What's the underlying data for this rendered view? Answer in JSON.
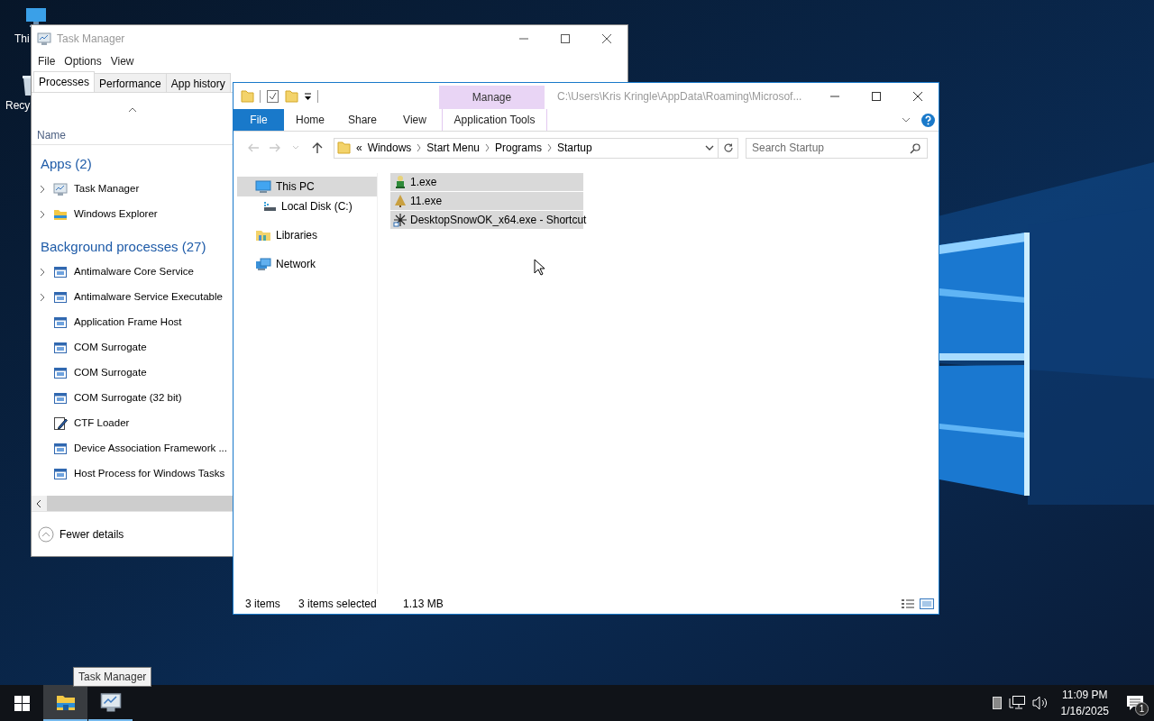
{
  "desktop": {
    "icons": [
      {
        "label": "Thi",
        "kind": "pc"
      },
      {
        "label": "Recy",
        "kind": "bin"
      }
    ]
  },
  "task_manager": {
    "title": "Task Manager",
    "menu": [
      "File",
      "Options",
      "View"
    ],
    "tabs": [
      {
        "label": "Processes",
        "selected": true
      },
      {
        "label": "Performance",
        "selected": false
      },
      {
        "label": "App history",
        "selected": false
      }
    ],
    "column": "Name",
    "groups": [
      {
        "title": "Apps (2)",
        "rows": [
          {
            "name": "Task Manager",
            "kind": "taskmgr",
            "expandable": true
          },
          {
            "name": "Windows Explorer",
            "kind": "explorer",
            "expandable": true
          }
        ]
      },
      {
        "title": "Background processes (27)",
        "rows": [
          {
            "name": "Antimalware Core Service",
            "kind": "service",
            "expandable": true
          },
          {
            "name": "Antimalware Service Executable",
            "kind": "service",
            "expandable": true
          },
          {
            "name": "Application Frame Host",
            "kind": "service",
            "expandable": false
          },
          {
            "name": "COM Surrogate",
            "kind": "service",
            "expandable": false
          },
          {
            "name": "COM Surrogate",
            "kind": "service",
            "expandable": false
          },
          {
            "name": "COM Surrogate (32 bit)",
            "kind": "service",
            "expandable": false
          },
          {
            "name": "CTF Loader",
            "kind": "pen",
            "expandable": false
          },
          {
            "name": "Device Association Framework ...",
            "kind": "service",
            "expandable": false
          },
          {
            "name": "Host Process for Windows Tasks",
            "kind": "service",
            "expandable": false
          }
        ]
      }
    ],
    "footer": "Fewer details"
  },
  "explorer": {
    "context_header": "Manage",
    "title": "C:\\Users\\Kris Kringle\\AppData\\Roaming\\Microsof...",
    "ribbon_tabs": [
      {
        "label": "File",
        "kind": "file"
      },
      {
        "label": "Home",
        "kind": "tab"
      },
      {
        "label": "Share",
        "kind": "tab"
      },
      {
        "label": "View",
        "kind": "tab"
      },
      {
        "label": "Application Tools",
        "kind": "contextual"
      }
    ],
    "address": {
      "overflow_marker": "«",
      "breadcrumbs": [
        "Windows",
        "Start Menu",
        "Programs",
        "Startup"
      ]
    },
    "search": {
      "placeholder": "Search Startup"
    },
    "nav": [
      {
        "label": "This PC",
        "kind": "pc",
        "selected": true,
        "children": [
          {
            "label": "Local Disk (C:)",
            "kind": "disk",
            "selected": false
          }
        ]
      },
      {
        "label": "Libraries",
        "kind": "libraries",
        "selected": false
      },
      {
        "label": "Network",
        "kind": "network",
        "selected": false
      }
    ],
    "files": [
      {
        "name": "1.exe",
        "kind": "figure",
        "selected": true
      },
      {
        "name": "11.exe",
        "kind": "tree",
        "selected": true
      },
      {
        "name": "DesktopSnowOK_x64.exe - Shortcut",
        "kind": "snow",
        "selected": true
      }
    ],
    "status": {
      "count": "3 items",
      "selection": "3 items selected",
      "size": "1.13 MB"
    }
  },
  "taskbar": {
    "buttons": [
      {
        "kind": "explorer",
        "selected": true
      },
      {
        "kind": "taskmgr",
        "selected": false
      }
    ],
    "tooltip": "Task Manager",
    "time": "11:09 PM",
    "date": "1/16/2025",
    "notifications": "1"
  }
}
